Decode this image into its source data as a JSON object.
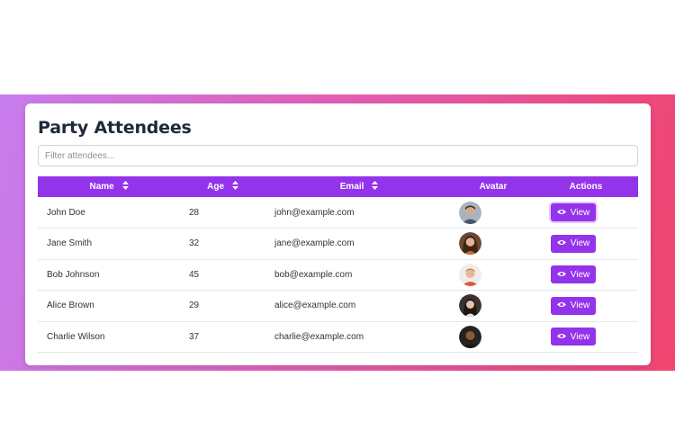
{
  "page": {
    "title": "Party Attendees",
    "filter_placeholder": "Filter attendees..."
  },
  "table": {
    "columns": [
      {
        "label": "Name",
        "sortable": true
      },
      {
        "label": "Age",
        "sortable": true
      },
      {
        "label": "Email",
        "sortable": true
      },
      {
        "label": "Avatar",
        "sortable": false
      },
      {
        "label": "Actions",
        "sortable": false
      }
    ],
    "rows": [
      {
        "name": "John Doe",
        "age": "28",
        "email": "john@example.com",
        "action": "View"
      },
      {
        "name": "Jane Smith",
        "age": "32",
        "email": "jane@example.com",
        "action": "View"
      },
      {
        "name": "Bob Johnson",
        "age": "45",
        "email": "bob@example.com",
        "action": "View"
      },
      {
        "name": "Alice Brown",
        "age": "29",
        "email": "alice@example.com",
        "action": "View"
      },
      {
        "name": "Charlie Wilson",
        "age": "37",
        "email": "charlie@example.com",
        "action": "View"
      }
    ]
  },
  "colors": {
    "accent": "#9333ea",
    "gradient_start": "#c77dee",
    "gradient_end": "#f0456f"
  }
}
